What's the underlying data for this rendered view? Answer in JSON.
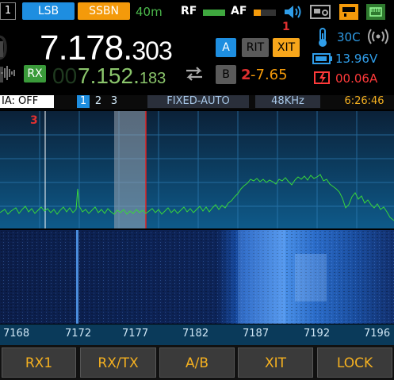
{
  "top_bar": {
    "vfo_index": "1",
    "mode_lsb": "LSB",
    "mode_ssbn": "SSBN",
    "band": "40m",
    "rf_label": "RF",
    "af_label": "AF",
    "marker_1": "1"
  },
  "right_panel": {
    "temperature": "30C",
    "voltage": "13.96V",
    "current": "00.06A"
  },
  "frequency": {
    "main_major": "7.178.",
    "main_minor": "303",
    "sub_major": "7.152.",
    "sub_minor": "183",
    "vfo_a": "A",
    "vfo_b": "B",
    "rit": "RIT",
    "xit": "XIT",
    "rx": "RX",
    "marker_2": "2",
    "offset": "-7.65"
  },
  "status": {
    "ia": "IA: OFF",
    "page1": "1",
    "page2": "2",
    "page3": "3",
    "mode": "FIXED-AUTO",
    "bandwidth": "48KHz",
    "time": "6:26:46"
  },
  "plot": {
    "marker_3": "3"
  },
  "axis_ticks": [
    "7168",
    "7172",
    "7177",
    "7182",
    "7187",
    "7192",
    "7196"
  ],
  "bottom_buttons": [
    "RX1",
    "RX/TX",
    "A/B",
    "XIT",
    "LOCK"
  ],
  "colors": {
    "accent_blue": "#1e8ee0",
    "accent_orange": "#f49a0a",
    "spectrum_green": "#39d63a",
    "warning_red": "#ff3a3a"
  }
}
